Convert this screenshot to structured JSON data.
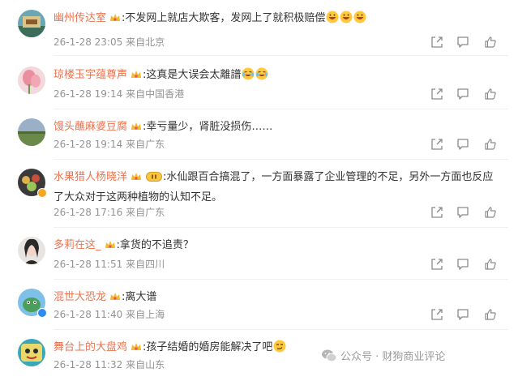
{
  "colors": {
    "username": "#eb7350",
    "meta": "#939393",
    "text": "#333333",
    "icon": "#8a8a8a"
  },
  "comments": [
    {
      "username": "幽州传达室",
      "text": "不发网上就店大欺客，发网上了就积极赔偿",
      "emoji_count": 3,
      "emoji_names": [
        "grin-emoji",
        "grin-emoji",
        "grin-emoji"
      ],
      "date": "26-1-28 23:05",
      "location": "来自北京"
    },
    {
      "username": "琼楼玉宇蕴尊声",
      "text": "这真是大误会太離譜",
      "emoji_names": [
        "cry-laugh-emoji",
        "cry-laugh-emoji"
      ],
      "date": "26-1-28 19:14",
      "location": "来自中国香港"
    },
    {
      "username": "馒头蘸麻婆豆腐",
      "text": "幸亏量少，肾脏没损伤……",
      "date": "26-1-28 19:14",
      "location": "来自广东"
    },
    {
      "username": "水果猎人杨晓洋",
      "text": "水仙跟百合搞混了，一方面暴露了企业管理的不足，另外一方面也反应了大众对于这两种植物的认知不足。",
      "date": "26-1-28 17:16",
      "location": "来自广东"
    },
    {
      "username": "多莉在这_",
      "text": "拿货的不追责？",
      "date": "26-1-28 11:51",
      "location": "来自四川"
    },
    {
      "username": "混世大恐龙",
      "text": "离大谱",
      "date": "26-1-28 11:40",
      "location": "来自上海"
    },
    {
      "username": "舞台上的大盘鸡",
      "text": "孩子结婚的婚房能解决了吧",
      "emoji_names": [
        "smirk-emoji"
      ],
      "date": "26-1-28 11:32",
      "location": "来自山东"
    }
  ],
  "separator": ":",
  "watermark": {
    "text": "公众号 · 财狗商业评论",
    "icon": "wechat-icon"
  },
  "action_icons": [
    "share-icon",
    "comment-icon",
    "like-icon"
  ]
}
